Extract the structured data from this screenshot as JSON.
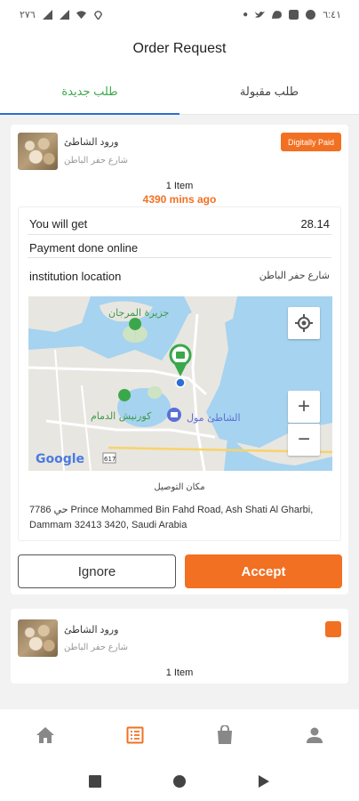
{
  "status_bar": {
    "time": "٦:٤١",
    "left_text": "٢٧٦"
  },
  "app_bar": {
    "title": "Order Request"
  },
  "tabs": [
    {
      "label": "طلب جديدة",
      "active": true
    },
    {
      "label": "طلب مقبولة",
      "active": false
    }
  ],
  "orders": [
    {
      "store_name": "ورود الشاطئ",
      "store_address": "شارع حفر الباطن",
      "badge": "Digitally Paid",
      "items": "1 Item",
      "time_ago": "4390 mins ago",
      "you_get_label": "You will get",
      "you_get_value": "28.14",
      "payment_text": "Payment done online",
      "institution_label": "institution location",
      "institution_value": "شارع حفر الباطن",
      "map": {
        "labels": [
          "جزيرة المرجان",
          "كورنيش الدمام",
          "الشاطئ مول",
          "Google",
          "617"
        ]
      },
      "delivery_label": "مكان التوصيل",
      "delivery_address": "7786 حي Prince Mohammed Bin Fahd Road, Ash Shati Al Gharbi, Dammam 32413 3420, Saudi Arabia",
      "ignore_label": "Ignore",
      "accept_label": "Accept"
    },
    {
      "store_name": "ورود الشاطئ",
      "store_address": "شارع حفر الباطن",
      "items": "1 Item"
    }
  ],
  "colors": {
    "accent": "#f27022",
    "tab_active_text": "#3aa84a",
    "tab_indicator": "#2a6fd6"
  },
  "bottom_nav": [
    {
      "icon": "home-icon",
      "active": false
    },
    {
      "icon": "orders-icon",
      "active": true
    },
    {
      "icon": "bag-icon",
      "active": false
    },
    {
      "icon": "profile-icon",
      "active": false
    }
  ]
}
